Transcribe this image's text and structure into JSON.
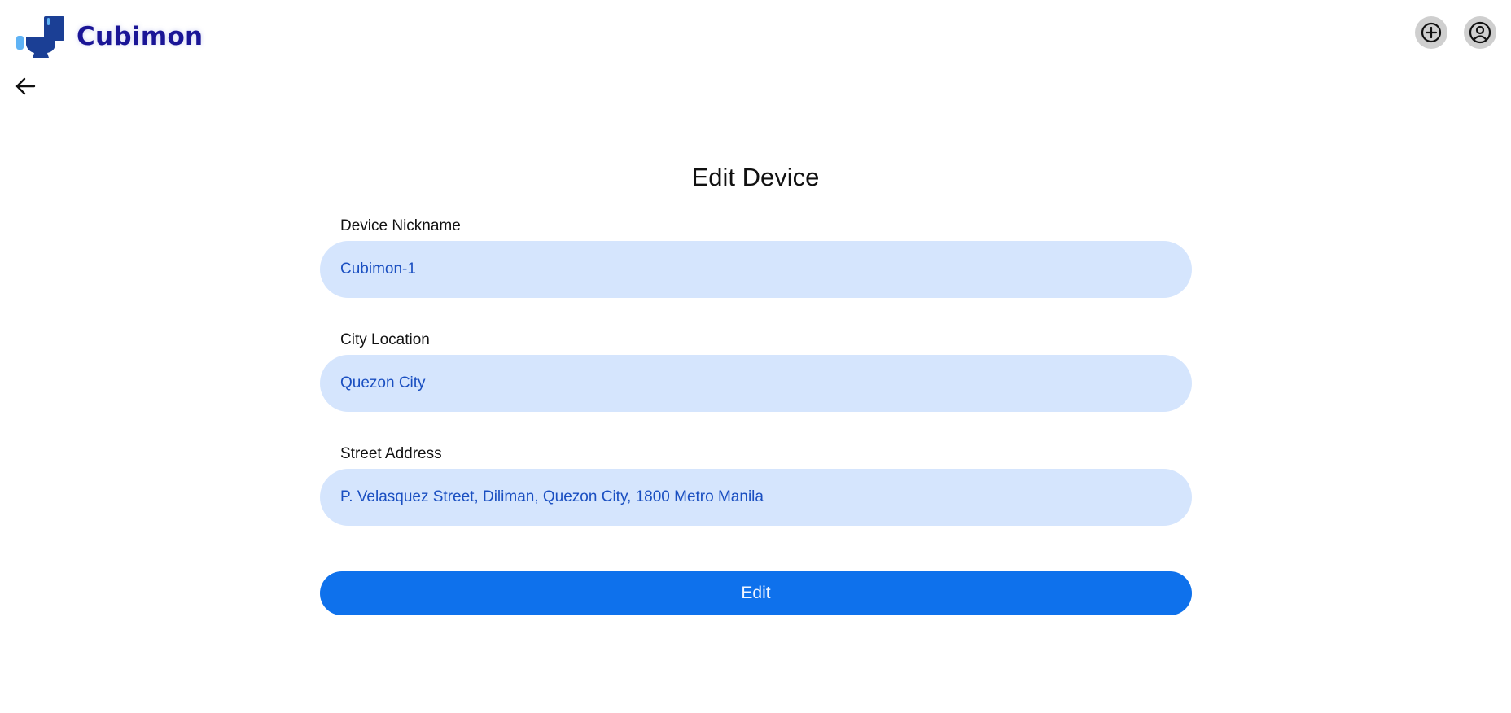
{
  "brand": {
    "name": "Cubimon",
    "logo_icon": "toilet-icon",
    "color": "#1a1596"
  },
  "header": {
    "add_icon": "plus-circle-icon",
    "profile_icon": "account-circle-icon"
  },
  "nav": {
    "back_icon": "arrow-left-icon"
  },
  "form": {
    "title": "Edit Device",
    "fields": [
      {
        "label": "Device Nickname",
        "value": "Cubimon-1"
      },
      {
        "label": "City Location",
        "value": "Quezon City"
      },
      {
        "label": "Street Address",
        "value": "P. Velasquez Street, Diliman, Quezon City, 1800 Metro Manila"
      }
    ],
    "submit_label": "Edit"
  },
  "colors": {
    "input_background": "#d5e5fd",
    "input_text": "#1a4fc1",
    "primary_button": "#0e71ec"
  }
}
